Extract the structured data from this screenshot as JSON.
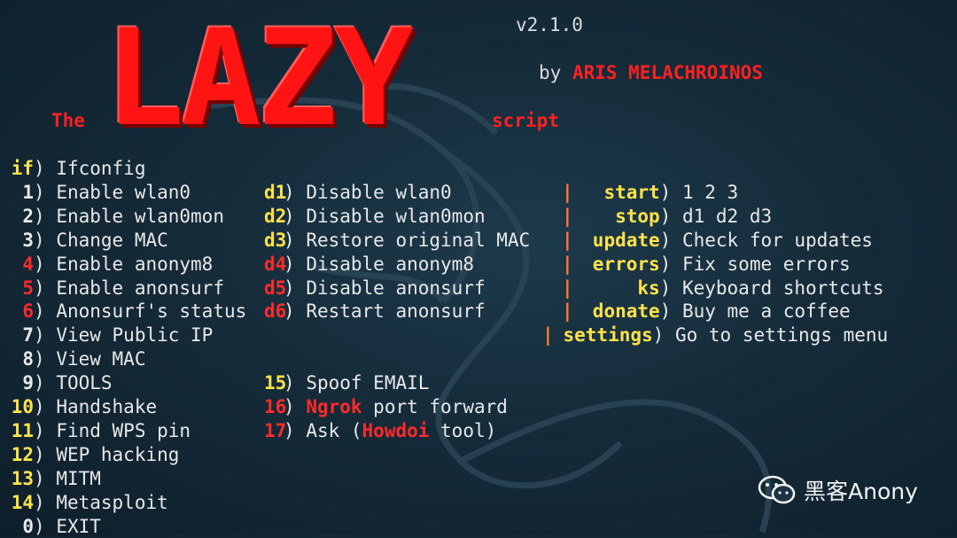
{
  "header": {
    "logo_text": "LAZY",
    "version": "v2.1.0",
    "by": "by",
    "author": "ARIS MELACHROINOS",
    "the": "The",
    "script": "script"
  },
  "menu_col1": [
    {
      "key": "if",
      "sep": ")",
      "label": "Ifconfig",
      "key_color": "yellow"
    },
    {
      "key": "1",
      "sep": ")",
      "label": "Enable wlan0",
      "key_color": "white"
    },
    {
      "key": "2",
      "sep": ")",
      "label": "Enable wlan0mon",
      "key_color": "white"
    },
    {
      "key": "3",
      "sep": ")",
      "label": "Change MAC",
      "key_color": "white"
    },
    {
      "key": "4",
      "sep": ")",
      "label": "Enable anonym8",
      "key_color": "red"
    },
    {
      "key": "5",
      "sep": ")",
      "label": "Enable anonsurf",
      "key_color": "red"
    },
    {
      "key": "6",
      "sep": ")",
      "label": "Anonsurf's status",
      "key_color": "red"
    },
    {
      "key": "7",
      "sep": ")",
      "label": "View Public IP",
      "key_color": "white"
    },
    {
      "key": "8",
      "sep": ")",
      "label": "View MAC",
      "key_color": "white"
    },
    {
      "key": "9",
      "sep": ")",
      "label": "TOOLS",
      "key_color": "white"
    },
    {
      "key": "10",
      "sep": ")",
      "label": "Handshake",
      "key_color": "yellow"
    },
    {
      "key": "11",
      "sep": ")",
      "label": "Find WPS pin",
      "key_color": "yellow"
    },
    {
      "key": "12",
      "sep": ")",
      "label": "WEP hacking",
      "key_color": "yellow"
    },
    {
      "key": "13",
      "sep": ")",
      "label": "MITM",
      "key_color": "yellow"
    },
    {
      "key": "14",
      "sep": ")",
      "label": "Metasploit",
      "key_color": "yellow"
    },
    {
      "key": "0",
      "sep": ")",
      "label": "EXIT",
      "key_color": "white"
    }
  ],
  "menu_col2": [
    {
      "key": "d1",
      "label": "Disable wlan0",
      "key_color": "yellow"
    },
    {
      "key": "d2",
      "label": "Disable wlan0mon",
      "key_color": "yellow"
    },
    {
      "key": "d3",
      "label": "Restore original MAC",
      "key_color": "yellow"
    },
    {
      "key": "d4",
      "label": "Disable anonym8",
      "key_color": "red"
    },
    {
      "key": "d5",
      "label": "Disable anonsurf",
      "key_color": "red"
    },
    {
      "key": "d6",
      "label": "Restart anonsurf",
      "key_color": "red"
    }
  ],
  "menu_col2_lower": [
    {
      "key": "15",
      "label": "Spoof EMAIL",
      "key_color": "yellow"
    },
    {
      "key": "16",
      "label_red": "Ngrok",
      "label": " port forward",
      "key_color": "red"
    },
    {
      "key": "17",
      "label_pre": "Ask (",
      "label_red": "Howdoi",
      "label": " tool)",
      "key_color": "red"
    }
  ],
  "menu_col3": [
    {
      "key": "start",
      "label": "1 2 3"
    },
    {
      "key": "stop",
      "label": "d1 d2 d3"
    },
    {
      "key": "update",
      "label": "Check for updates"
    },
    {
      "key": "errors",
      "label": "Fix some errors"
    },
    {
      "key": "ks",
      "label": "Keyboard shortcuts"
    },
    {
      "key": "donate",
      "label": "Buy me a coffee"
    },
    {
      "key": "settings",
      "label": "Go to settings menu"
    }
  ],
  "bar_char": "|",
  "paren": ")",
  "watermark": "黑客Anony",
  "colors": {
    "red": "#ff1414",
    "yellow": "#ffe24a",
    "orange_bar": "#ff7a2a"
  }
}
